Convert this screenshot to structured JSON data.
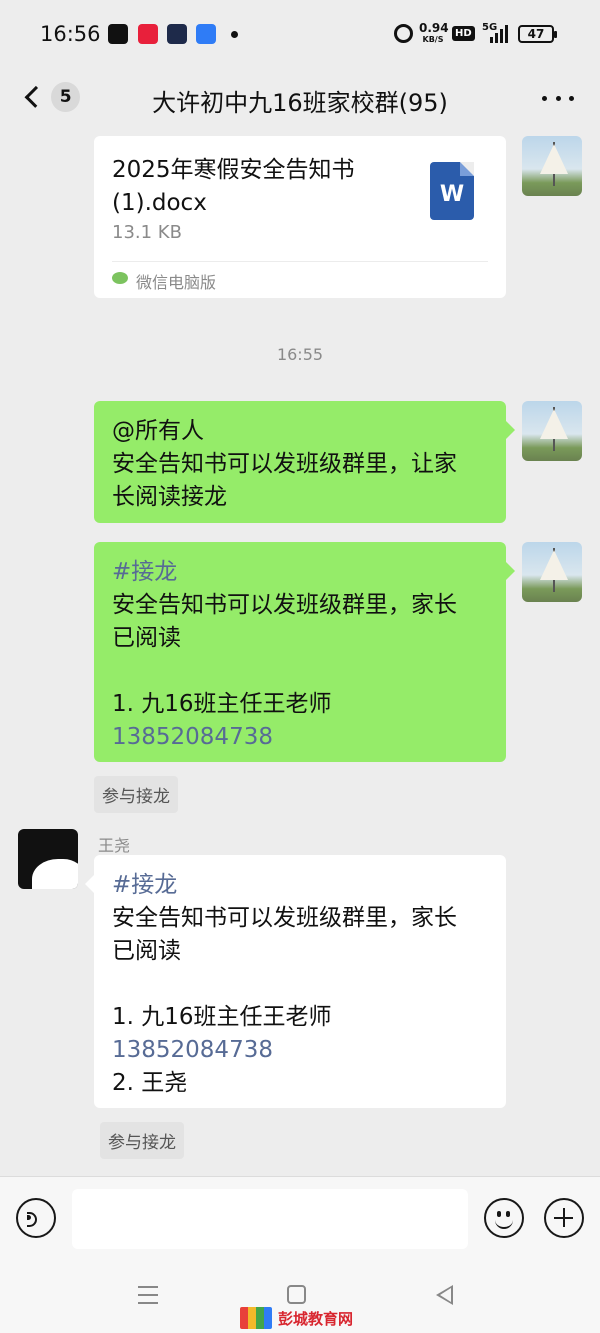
{
  "status_bar": {
    "time": "16:56",
    "net_speed_value": "0.94",
    "net_speed_unit": "KB/S",
    "hd": "HD",
    "network": "5G",
    "battery": "47"
  },
  "header": {
    "unread_count": "5",
    "title": "大许初中九16班家校群(95)"
  },
  "messages": {
    "file": {
      "name": "2025年寒假安全告知书(1).docx",
      "size": "13.1 KB",
      "icon_letter": "W",
      "source": "微信电脑版"
    },
    "timestamp": "16:55",
    "announce": {
      "mention": "@所有人",
      "line1": "安全告知书可以发班级群里，让家",
      "line2": "长阅读接龙"
    },
    "jielong_mine": {
      "tag": "#接龙",
      "line1": "安全告知书可以发班级群里，家长",
      "line2": "已阅读",
      "entry1": "1. 九16班主任王老师",
      "phone": "13852084738",
      "join_label": "参与接龙"
    },
    "jielong_other": {
      "sender": "王尧",
      "tag": "#接龙",
      "line1": "安全告知书可以发班级群里，家长",
      "line2": "已阅读",
      "entry1": "1. 九16班主任王老师",
      "phone": "13852084738",
      "entry2": "2. 王尧",
      "join_label": "参与接龙"
    }
  },
  "input": {
    "placeholder": ""
  },
  "watermark": {
    "text": "彭城教育网"
  },
  "colors": {
    "chat_bg": "#ededed",
    "bubble_green": "#95ec69",
    "bubble_white": "#ffffff",
    "link_blue": "#576b95",
    "word_blue": "#2b5cab"
  }
}
